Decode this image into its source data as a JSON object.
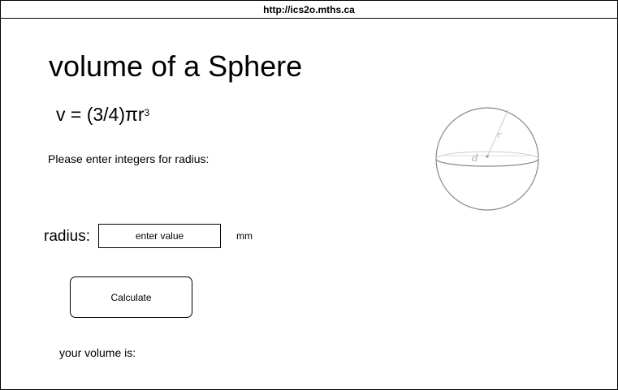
{
  "browser": {
    "url": "http://ics2o.mths.ca"
  },
  "page": {
    "title": "volume of a Sphere",
    "formula_prefix": "v = (3/4)πr",
    "formula_exponent": "3",
    "instructions": "Please enter integers for radius:",
    "radius_label": "radius:",
    "radius_placeholder": "enter value",
    "radius_value": "",
    "unit": "mm",
    "calculate_label": "Calculate",
    "result_label": "your volume is:"
  },
  "sphere_diagram": {
    "radius_letter": "r",
    "diameter_letter": "d"
  },
  "colors": {
    "background": "#ffffff",
    "border": "#000000",
    "diagram_outline": "#888888",
    "diagram_faint": "#cccccc"
  }
}
